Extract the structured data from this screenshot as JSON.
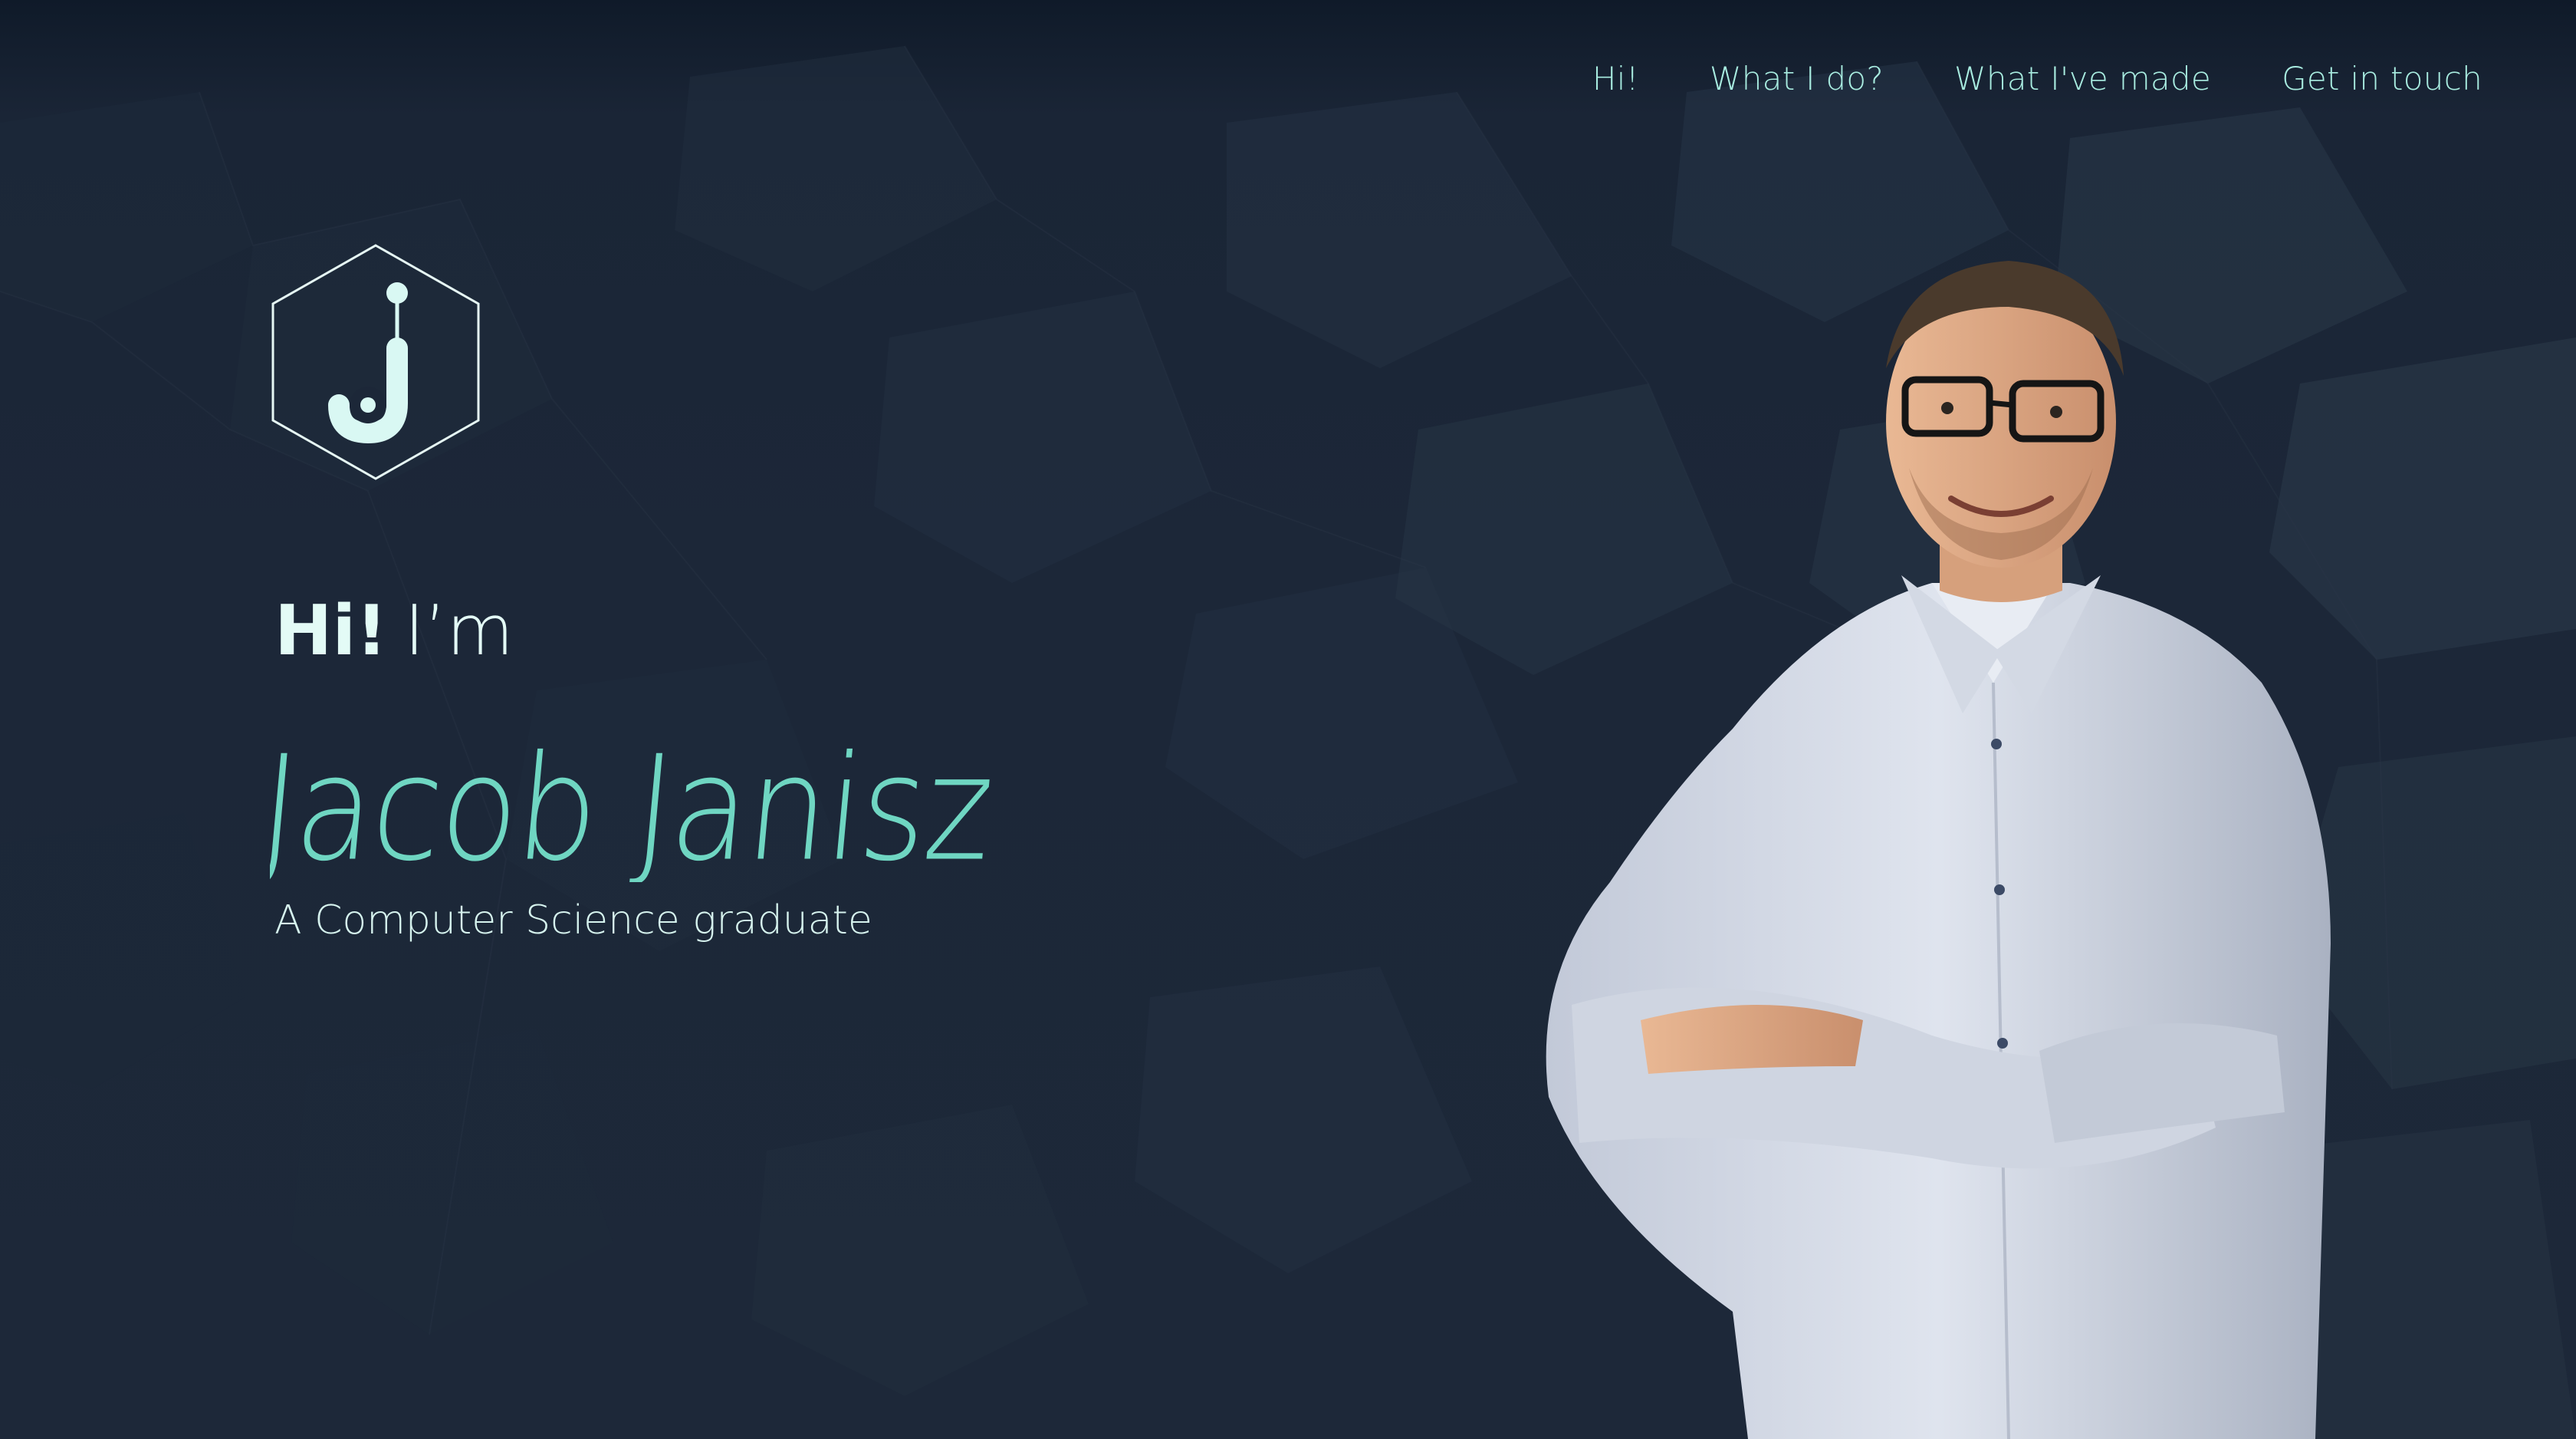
{
  "nav": {
    "items": [
      {
        "label": "Hi!"
      },
      {
        "label": "What I do?"
      },
      {
        "label": "What I've made"
      },
      {
        "label": "Get in touch"
      }
    ]
  },
  "logo": {
    "icon": "hexagon-j-logo-icon"
  },
  "hero": {
    "greeting_bold": "Hi!",
    "greeting_rest": "I’m",
    "name": "Jacob Janisz",
    "subtitle": "A Computer Science graduate"
  },
  "portrait": {
    "icon": "portrait-photo"
  },
  "colors": {
    "background": "#1c2738",
    "accent": "#6fd6c2",
    "text": "#e3fbf6"
  }
}
